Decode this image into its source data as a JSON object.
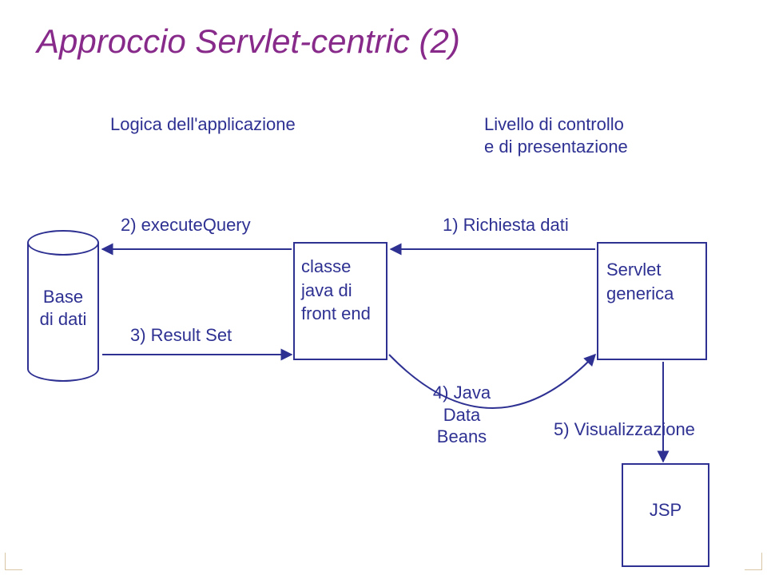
{
  "title": "Approccio Servlet-centric (2)",
  "left_heading": "Logica dell'applicazione",
  "right_heading_line1": "Livello di controllo",
  "right_heading_line2": "e di presentazione",
  "db_label_line1": "Base",
  "db_label_line2": "di dati",
  "arrow_execute": "2) executeQuery",
  "arrow_resultset": "3) Result Set",
  "arrow_request": "1) Richiesta dati",
  "arrow_javabeans_line1": "4) Java",
  "arrow_javabeans_line2": "Data",
  "arrow_javabeans_line3": "Beans",
  "arrow_visual": "5) Visualizzazione",
  "box_classe_line1": "classe",
  "box_classe_line2": "java di",
  "box_classe_line3": "front end",
  "box_servlet_line1": "Servlet",
  "box_servlet_line2": "generica",
  "box_jsp": "JSP"
}
